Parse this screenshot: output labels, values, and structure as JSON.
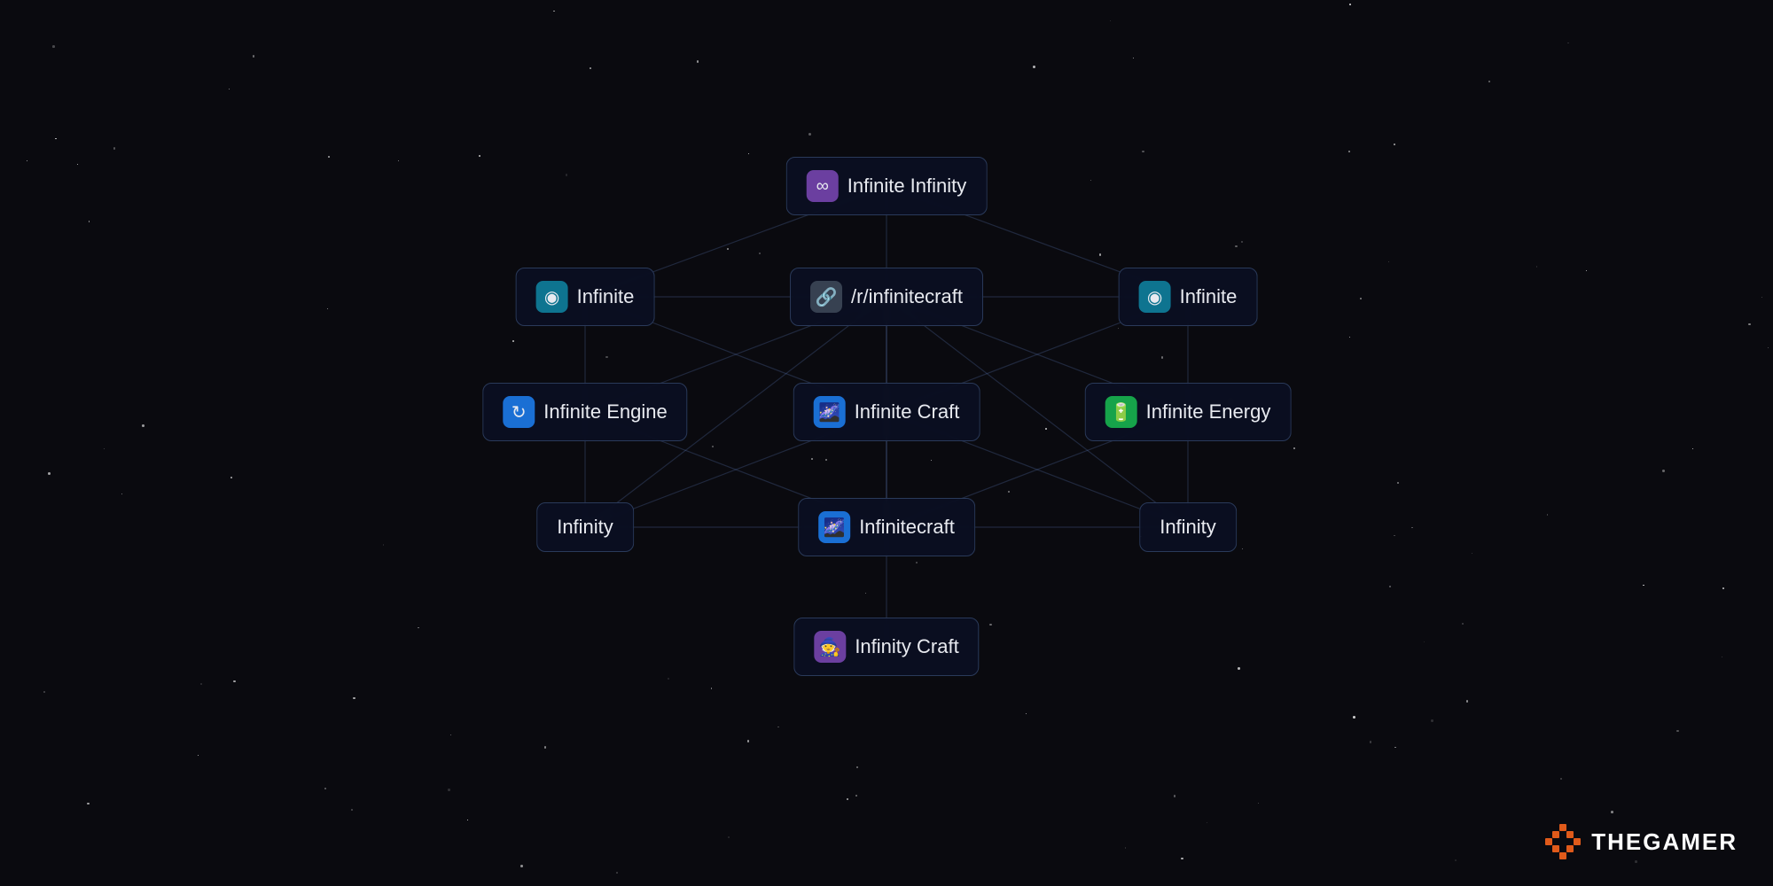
{
  "background": "#0a0a0f",
  "brand": {
    "name": "THEGAMER",
    "icon_color": "#e05a1a"
  },
  "nodes": [
    {
      "id": "infinite-infinity",
      "label": "Infinite Infinity",
      "icon": "∞",
      "icon_class": "icon-purple",
      "col": "center",
      "row": 0
    },
    {
      "id": "infinite-left",
      "label": "Infinite",
      "icon": "🔵",
      "icon_class": "icon-teal",
      "col": "left",
      "row": 1
    },
    {
      "id": "r-infinitecraft",
      "label": "/r/infinitecraft",
      "icon": "🔗",
      "icon_class": "icon-link",
      "col": "center",
      "row": 1
    },
    {
      "id": "infinite-right",
      "label": "Infinite",
      "icon": "🔵",
      "icon_class": "icon-teal",
      "col": "right",
      "row": 1
    },
    {
      "id": "infinite-engine",
      "label": "Infinite Engine",
      "icon": "🔄",
      "icon_class": "icon-blue",
      "col": "left",
      "row": 2
    },
    {
      "id": "infinite-craft",
      "label": "Infinite Craft",
      "icon": "🌌",
      "icon_class": "icon-blue",
      "col": "center",
      "row": 2
    },
    {
      "id": "infinite-energy",
      "label": "Infinite Energy",
      "icon": "🔋",
      "icon_class": "icon-green",
      "col": "right",
      "row": 2
    },
    {
      "id": "infinity-left",
      "label": "Infinity",
      "icon": null,
      "icon_class": null,
      "col": "left",
      "row": 3
    },
    {
      "id": "infinitecraft",
      "label": "Infinitecraft",
      "icon": "🌌",
      "icon_class": "icon-blue",
      "col": "center",
      "row": 3
    },
    {
      "id": "infinity-right",
      "label": "Infinity",
      "icon": null,
      "icon_class": null,
      "col": "right",
      "row": 3
    },
    {
      "id": "infinity-craft",
      "label": "Infinity Craft",
      "icon": "🧙",
      "icon_class": "icon-purple",
      "col": "center",
      "row": 4
    }
  ],
  "connections": [
    [
      "infinite-infinity",
      "infinite-left"
    ],
    [
      "infinite-infinity",
      "r-infinitecraft"
    ],
    [
      "infinite-infinity",
      "infinite-right"
    ],
    [
      "infinite-left",
      "r-infinitecraft"
    ],
    [
      "infinite-left",
      "infinite-engine"
    ],
    [
      "infinite-left",
      "infinite-craft"
    ],
    [
      "r-infinitecraft",
      "infinite-right"
    ],
    [
      "r-infinitecraft",
      "infinite-engine"
    ],
    [
      "r-infinitecraft",
      "infinite-craft"
    ],
    [
      "r-infinitecraft",
      "infinite-energy"
    ],
    [
      "r-infinitecraft",
      "infinity-left"
    ],
    [
      "r-infinitecraft",
      "infinitecraft"
    ],
    [
      "r-infinitecraft",
      "infinity-right"
    ],
    [
      "infinite-right",
      "infinite-craft"
    ],
    [
      "infinite-right",
      "infinite-energy"
    ],
    [
      "infinite-engine",
      "infinity-left"
    ],
    [
      "infinite-engine",
      "infinitecraft"
    ],
    [
      "infinite-craft",
      "infinity-left"
    ],
    [
      "infinite-craft",
      "infinitecraft"
    ],
    [
      "infinite-craft",
      "infinity-right"
    ],
    [
      "infinite-energy",
      "infinitecraft"
    ],
    [
      "infinite-energy",
      "infinity-right"
    ],
    [
      "infinity-left",
      "infinitecraft"
    ],
    [
      "infinitecraft",
      "infinity-right"
    ],
    [
      "infinitecraft",
      "infinity-craft"
    ]
  ]
}
